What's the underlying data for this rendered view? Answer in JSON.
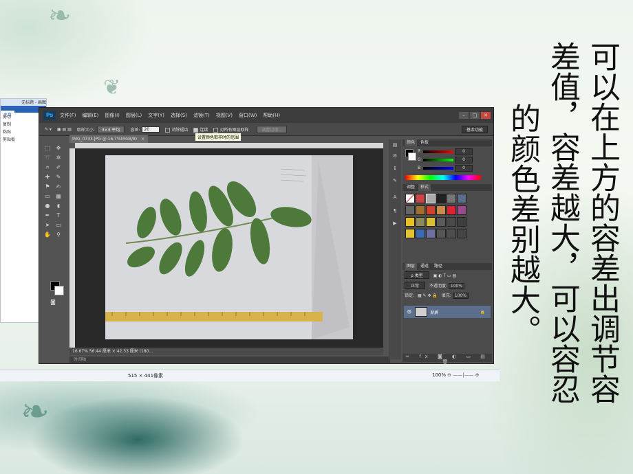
{
  "slide": {
    "text_columns": [
      "可以在上方的容差出调节容",
      "差值，容差越大，可以容忍",
      "的颜色差别越大。"
    ]
  },
  "paint": {
    "title": "无标题 - 画图",
    "tabs": [
      "主页"
    ],
    "tools": [
      "剪切",
      "复制",
      "粘贴",
      "剪贴板"
    ],
    "status": {
      "size": "515 × 441像素",
      "zoom": "100%"
    }
  },
  "photoshop": {
    "logo": "Ps",
    "menus": [
      "文件(F)",
      "编辑(E)",
      "图像(I)",
      "图层(L)",
      "文字(Y)",
      "选择(S)",
      "滤镜(T)",
      "视图(V)",
      "窗口(W)",
      "帮助(H)"
    ],
    "window_buttons": [
      "–",
      "□",
      "✕"
    ],
    "options": {
      "sample_label": "取样大小:",
      "sample_value": "3×3 平均",
      "tolerance_label": "容差:",
      "tolerance_value": "20",
      "antialias": "消除锯齿",
      "contiguous": "连续",
      "all_layers": "对所有图层取样",
      "refine": "调整边缘...",
      "workspace": "基本功能"
    },
    "tooltip": "设置颜色取样时的范围",
    "doc_tab": "IMG_0733.JPG @ 16.7%(RGB/8)",
    "doc_status": "16.67%    56.44 厘米 × 42.33 厘米 (180...",
    "bottom_label": "时间轴",
    "color_panel": {
      "tabs": [
        "颜色",
        "色板"
      ],
      "channels": [
        {
          "label": "R",
          "value": "0"
        },
        {
          "label": "G",
          "value": "0"
        },
        {
          "label": "B",
          "value": "0"
        }
      ]
    },
    "styles_panel": {
      "tabs": [
        "调整",
        "样式"
      ]
    },
    "layers_panel": {
      "tabs": [
        "图层",
        "通道",
        "路径"
      ],
      "kind_label": "ρ 类型",
      "blend_mode": "正常",
      "opacity_label": "不透明度:",
      "opacity": "100%",
      "lock_label": "锁定:",
      "fill_label": "填充:",
      "fill": "100%",
      "layer_name": "背景"
    }
  }
}
